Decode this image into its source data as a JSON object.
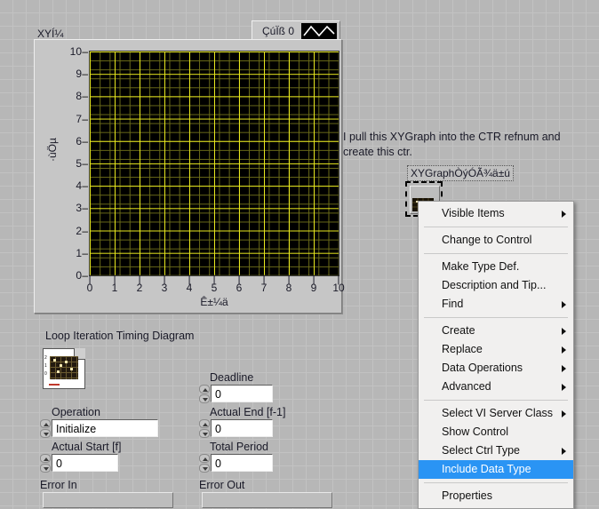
{
  "graph": {
    "title": "XYÍ¼",
    "legend": {
      "plot_name": "ÇúÏß 0",
      "icon": "waveform-icon"
    },
    "y_label": "·ùÖµ",
    "x_label": "Ê±¼ä",
    "y_ticks": [
      "10",
      "9",
      "8",
      "7",
      "6",
      "5",
      "4",
      "3",
      "2",
      "1",
      "0"
    ],
    "x_ticks": [
      "0",
      "1",
      "2",
      "3",
      "4",
      "5",
      "6",
      "7",
      "8",
      "9",
      "10"
    ],
    "colors": {
      "plot_background": "#000000",
      "minor_grid": "#6b6b19",
      "major_grid": "#e8e81e",
      "panel": "#c6c6c6"
    }
  },
  "chart_data": {
    "type": "scatter",
    "title": "XYÍ¼",
    "xlabel": "Ê±¼ä",
    "ylabel": "·ùÖµ",
    "xlim": [
      0,
      10
    ],
    "ylim": [
      0,
      10
    ],
    "xticks": [
      0,
      1,
      2,
      3,
      4,
      5,
      6,
      7,
      8,
      9,
      10
    ],
    "yticks": [
      0,
      1,
      2,
      3,
      4,
      5,
      6,
      7,
      8,
      9,
      10
    ],
    "grid": true,
    "legend_position": "top-right",
    "series": [
      {
        "name": "ÇúÏß 0",
        "x": [],
        "y": [],
        "color": "#ffffff"
      }
    ]
  },
  "annotation": {
    "text": "I pull this XYGraph into the CTR refnum and create this ctr."
  },
  "refnum": {
    "label": "XYGraphÒýÓÃ¾ä±ú"
  },
  "context_menu": {
    "groups": [
      [
        {
          "label": "Visible Items",
          "submenu": true,
          "selected": false
        }
      ],
      [
        {
          "label": "Change to Control",
          "submenu": false,
          "selected": false
        }
      ],
      [
        {
          "label": "Make Type Def.",
          "submenu": false,
          "selected": false
        },
        {
          "label": "Description and Tip...",
          "submenu": false,
          "selected": false
        },
        {
          "label": "Find",
          "submenu": true,
          "selected": false
        }
      ],
      [
        {
          "label": "Create",
          "submenu": true,
          "selected": false
        },
        {
          "label": "Replace",
          "submenu": true,
          "selected": false
        },
        {
          "label": "Data Operations",
          "submenu": true,
          "selected": false
        },
        {
          "label": "Advanced",
          "submenu": true,
          "selected": false
        }
      ],
      [
        {
          "label": "Select VI Server Class",
          "submenu": true,
          "selected": false
        },
        {
          "label": "Show Control",
          "submenu": false,
          "selected": false
        },
        {
          "label": "Select Ctrl Type",
          "submenu": true,
          "selected": false
        },
        {
          "label": "Include Data Type",
          "submenu": false,
          "selected": true
        }
      ],
      [
        {
          "label": "Properties",
          "submenu": false,
          "selected": false
        }
      ]
    ],
    "highlight_color": "#2a94f4"
  },
  "panel": {
    "loop_diagram_label": "Loop Iteration Timing Diagram",
    "controls": {
      "operation": {
        "label": "Operation",
        "value": "Initialize"
      },
      "actual_start": {
        "label": "Actual Start [f]",
        "value": "0"
      },
      "error_in": {
        "label": "Error In"
      },
      "deadline": {
        "label": "Deadline",
        "value": "0"
      },
      "actual_end": {
        "label": "Actual End [f-1]",
        "value": "0"
      },
      "total_period": {
        "label": "Total Period",
        "value": "0"
      },
      "error_out": {
        "label": "Error Out"
      }
    }
  }
}
